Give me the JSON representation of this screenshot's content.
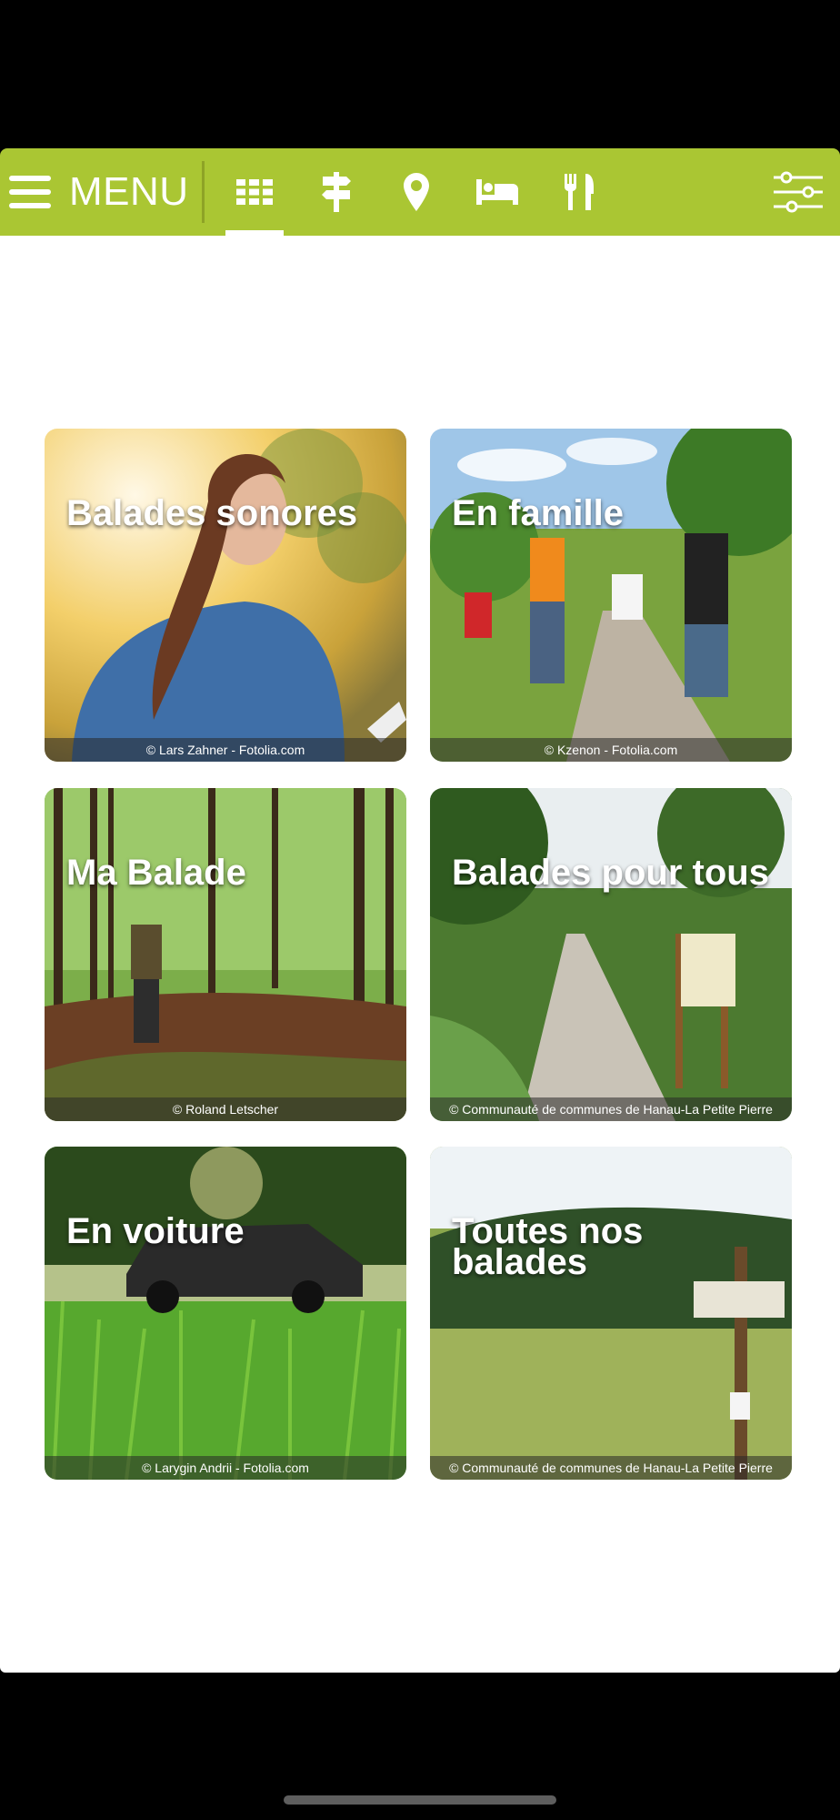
{
  "navbar": {
    "menu_label": "MENU",
    "accent_color": "#aac633",
    "icons": [
      "grid-icon",
      "signpost-icon",
      "map-pin-icon",
      "bed-icon",
      "fork-knife-icon",
      "filter-sliders-icon"
    ],
    "active_tab": "grid-icon"
  },
  "tiles": [
    {
      "title": "Balades sonores",
      "credit": "© Lars Zahner - Fotolia.com"
    },
    {
      "title": "En famille",
      "credit": "© Kzenon - Fotolia.com"
    },
    {
      "title": "Ma Balade",
      "credit": "© Roland Letscher"
    },
    {
      "title": "Balades pour tous",
      "credit": "© Communauté de communes de Hanau-La Petite Pierre"
    },
    {
      "title": "En voiture",
      "credit": "© Larygin Andrii - Fotolia.com"
    },
    {
      "title": "Toutes nos\nbalades",
      "credit": "© Communauté de communes de Hanau-La Petite Pierre"
    }
  ]
}
